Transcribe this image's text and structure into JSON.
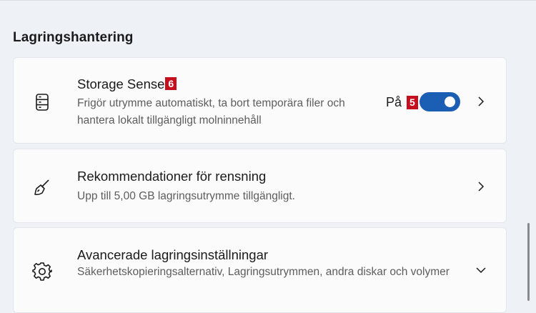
{
  "section": {
    "title": "Lagringshantering"
  },
  "cards": [
    {
      "icon": "storage-drive-icon",
      "title": "Storage Sense",
      "badge": "6",
      "description": "Frigör utrymme automatiskt, ta bort temporära filer och hantera lokalt tillgängligt molninnehåll",
      "state_label": "På",
      "state_badge": "5",
      "toggle_on": true,
      "action": "chevron-right-icon"
    },
    {
      "icon": "broom-icon",
      "title": "Rekommendationer för rensning",
      "description": "Upp till 5,00 GB lagringsutrymme tillgängligt.",
      "action": "chevron-right-icon"
    },
    {
      "icon": "gear-icon",
      "title": "Avancerade lagringsinställningar",
      "description": "Säkerhetskopieringsalternativ, Lagringsutrymmen, andra diskar och volymer",
      "action": "chevron-down-icon"
    }
  ],
  "colors": {
    "accent": "#1a5fb4",
    "badge": "#c50f1f",
    "background": "#eef1f6",
    "card": "#fbfbfc"
  }
}
